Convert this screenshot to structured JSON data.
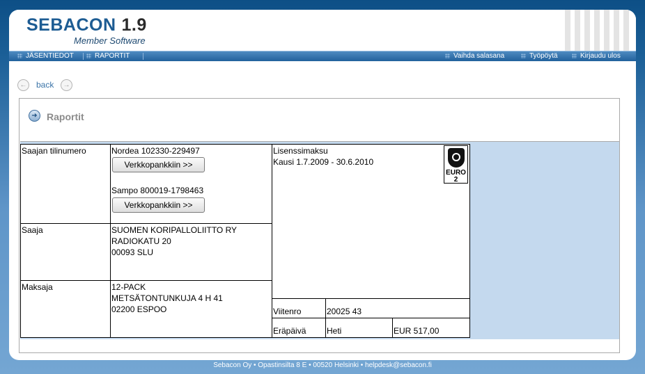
{
  "app": {
    "logo_text": "SEBACON",
    "version": "1.9",
    "subtitle": "Member Software"
  },
  "nav": {
    "left": [
      "JÄSENTIEDOT",
      "RAPORTIT"
    ],
    "right": [
      "Vaihda salasana",
      "Työpöytä",
      "Kirjaudu ulos"
    ]
  },
  "back_label": "back",
  "panel_title": "Raportit",
  "payment": {
    "account_label": "Saajan tilinumero",
    "bank1": "Nordea 102330-229497",
    "bank2": "Sampo 800019-1798463",
    "bank_button": "Verkkopankkiin >>",
    "payee_label": "Saaja",
    "payee_lines": [
      "SUOMEN KORIPALLOLIITTO RY",
      "RADIOKATU 20",
      "00093 SLU"
    ],
    "payer_label": "Maksaja",
    "payer_lines": [
      "12-PACK",
      "METSÄTONTUNKUJA 4 H 41",
      "02200 ESPOO"
    ],
    "info_line1": "Lisenssimaksu",
    "info_line2": "Kausi 1.7.2009 - 30.6.2010",
    "logo_text1": "EURO",
    "logo_text2": "2",
    "reference_label": "Viitenro",
    "reference": "20025 43",
    "due_label": "Eräpäivä",
    "due": "Heti",
    "amount": "EUR 517,00"
  },
  "footer": "Sebacon Oy • Opastinsilta 8 E • 00520 Helsinki • helpdesk@sebacon.fi",
  "colors": {
    "brand_blue": "#1d5c93",
    "nav_blue": "#21619c",
    "panel_fill": "#c4d9ee"
  }
}
